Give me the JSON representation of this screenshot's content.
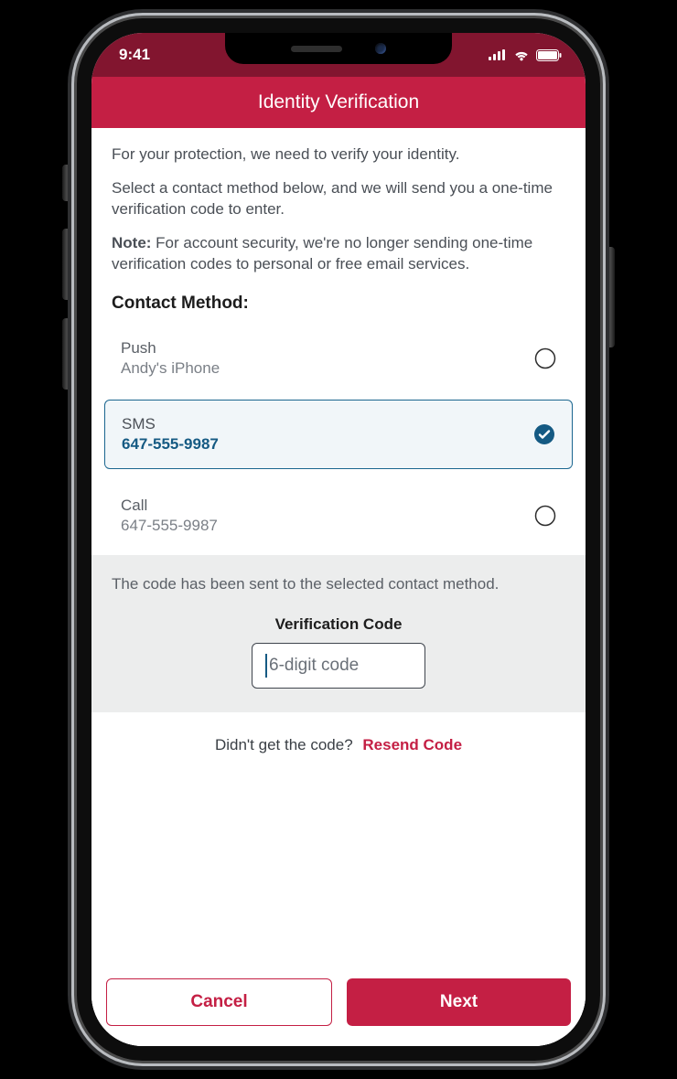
{
  "status": {
    "time": "9:41"
  },
  "header": {
    "title": "Identity Verification"
  },
  "intro": {
    "line1": "For your protection, we need to verify your identity.",
    "line2": "Select a contact method below, and we will send you a one-time verification code to enter.",
    "note_label": "Note:",
    "note_text": " For account security, we're no longer sending one-time verification codes to personal or free email services."
  },
  "contact": {
    "section_title": "Contact Method:",
    "methods": [
      {
        "label": "Push",
        "value": "Andy's iPhone",
        "selected": false
      },
      {
        "label": "SMS",
        "value": "647-555-9987",
        "selected": true
      },
      {
        "label": "Call",
        "value": "647-555-9987",
        "selected": false
      }
    ]
  },
  "code": {
    "sent_msg": "The code has been sent to the selected contact method.",
    "label": "Verification Code",
    "placeholder": "6-digit code"
  },
  "resend": {
    "prompt": "Didn't get the code?",
    "link": "Resend Code"
  },
  "footer": {
    "cancel": "Cancel",
    "next": "Next"
  },
  "colors": {
    "brand": "#c41f44",
    "brand_dark": "#82152f",
    "accent_blue": "#155a83"
  }
}
